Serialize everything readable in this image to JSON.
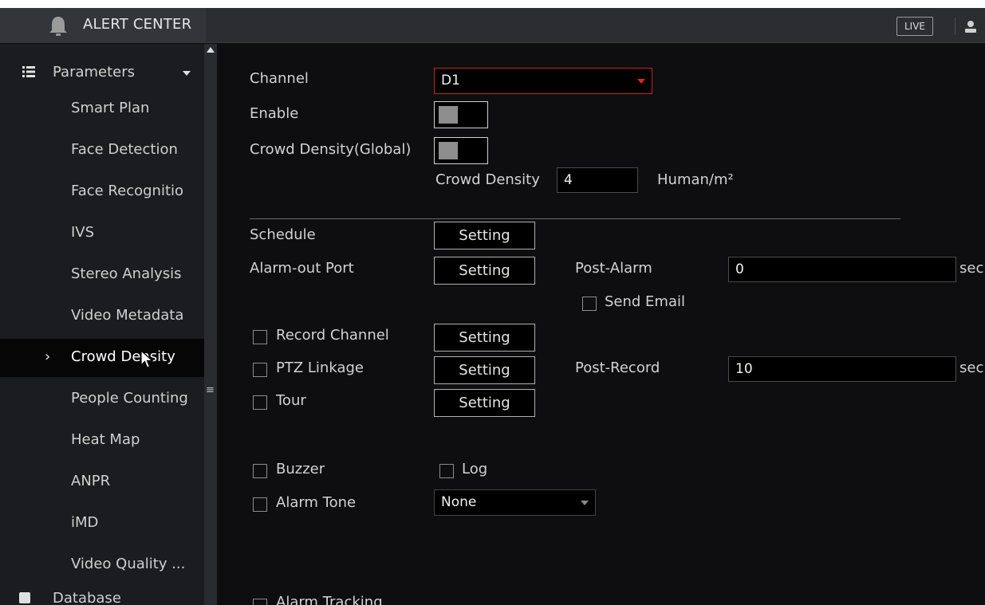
{
  "app": {
    "title": "ALERT CENTER",
    "live_label": "LIVE"
  },
  "sidebar": {
    "group_label": "Parameters",
    "items": [
      {
        "label": "Smart Plan"
      },
      {
        "label": "Face Detection"
      },
      {
        "label": "Face Recognitio"
      },
      {
        "label": "IVS"
      },
      {
        "label": "Stereo Analysis"
      },
      {
        "label": "Video Metadata"
      },
      {
        "label": "Crowd Density",
        "active": true
      },
      {
        "label": "People Counting"
      },
      {
        "label": "Heat Map"
      },
      {
        "label": "ANPR"
      },
      {
        "label": "iMD"
      },
      {
        "label": "Video Quality ..."
      }
    ],
    "next_group_label": "Database",
    "active_chevron": "›",
    "scroll_grip": "≡"
  },
  "form": {
    "channel_label": "Channel",
    "channel_value": "D1",
    "enable_label": "Enable",
    "crowd_global_label": "Crowd Density(Global)",
    "crowd_density_label": "Crowd Density",
    "crowd_density_value": "4",
    "crowd_density_unit": "Human/m²",
    "schedule_label": "Schedule",
    "alarm_out_label": "Alarm-out Port",
    "post_alarm_label": "Post-Alarm",
    "post_alarm_value": "0",
    "sec_label": "sec.",
    "send_email_label": "Send Email",
    "record_channel_label": "Record Channel",
    "ptz_linkage_label": "PTZ Linkage",
    "post_record_label": "Post-Record",
    "post_record_value": "10",
    "tour_label": "Tour",
    "buzzer_label": "Buzzer",
    "log_label": "Log",
    "alarm_tone_label": "Alarm Tone",
    "alarm_tone_value": "None",
    "alarm_tracking_label": "Alarm Tracking",
    "setting_label": "Setting"
  },
  "colors": {
    "accent_red": "#e52525",
    "background": "#0e0e10",
    "sidebar": "#1b1c1f",
    "titlebar": "#2b2d31"
  },
  "icons": [
    "bell-icon",
    "user-icon",
    "list-icon",
    "caret-down-icon",
    "scroll-up-icon",
    "cursor-icon",
    "database-icon"
  ]
}
